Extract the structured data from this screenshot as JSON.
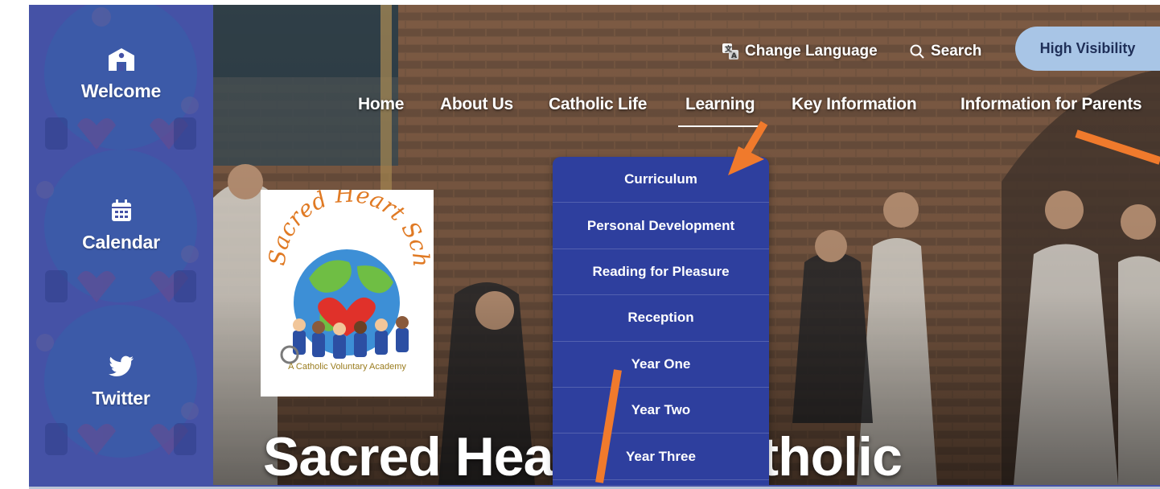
{
  "sidebar": {
    "items": [
      {
        "label": "Welcome",
        "icon": "school-icon"
      },
      {
        "label": "Calendar",
        "icon": "calendar-icon"
      },
      {
        "label": "Twitter",
        "icon": "twitter-icon"
      }
    ]
  },
  "utility": {
    "language_label": "Change Language",
    "search_label": "Search",
    "high_visibility_label": "High Visibility"
  },
  "nav": {
    "items": [
      "Home",
      "About Us",
      "Catholic Life",
      "Learning",
      "Key Information",
      "Information for Parents"
    ],
    "active": "Learning"
  },
  "dropdown": {
    "items": [
      "Curriculum",
      "Personal Development",
      "Reading for Pleasure",
      "Reception",
      "Year One",
      "Year Two",
      "Year Three"
    ]
  },
  "logo": {
    "name": "Sacred Heart School",
    "tagline": "A Catholic Voluntary Academy"
  },
  "hero": {
    "title": "Sacred Hea    ol, A Catholic"
  },
  "colors": {
    "sidebar_bg": "#4552a6",
    "dropdown_bg": "#2e3f9e",
    "hv_button_bg": "#a8c5e6",
    "annotation_arrow": "#f07a2c"
  }
}
